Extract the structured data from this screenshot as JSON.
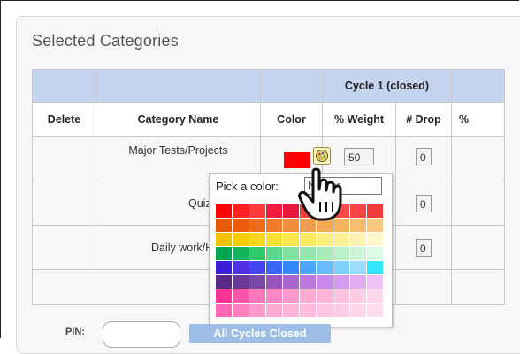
{
  "section_title": "Selected Categories",
  "table": {
    "group_header": "Cycle 1 (closed)",
    "columns": [
      "Delete",
      "Category Name",
      "Color",
      "% Weight",
      "# Drop",
      "%"
    ],
    "rows": [
      {
        "category": "Major Tests/Projects",
        "weight": "50",
        "drop": "0",
        "color": "#ff0000"
      },
      {
        "category": "Quiz/lab",
        "weight": "",
        "drop": "0"
      },
      {
        "category": "Daily work/Ho",
        "weight": "",
        "drop": "0"
      }
    ],
    "total_fragment": "0"
  },
  "color_picker": {
    "label": "Pick a color:",
    "input_value": "Noolor",
    "palette": [
      "#ff0000",
      "#ff2020",
      "#ff3b3b",
      "#f21d3e",
      "#e8193a",
      "#f33e3e",
      "#ff5a4c",
      "#ff4848",
      "#f74444",
      "#f23b3b",
      "#e85a00",
      "#ea5c0b",
      "#ee6b1a",
      "#f07a2a",
      "#f28b3a",
      "#f29d4d",
      "#f5a955",
      "#f7b460",
      "#f7bd70",
      "#f7c880",
      "#f2c200",
      "#f5cc00",
      "#f7d51a",
      "#f9de33",
      "#fbe64d",
      "#fbe866",
      "#fdee80",
      "#fdf099",
      "#fef3b3",
      "#fff7cc",
      "#00a651",
      "#14b35c",
      "#2ec96d",
      "#5cd68a",
      "#80e0a0",
      "#93e6ac",
      "#a5eab8",
      "#b8f0c8",
      "#cbf5d6",
      "#ddfae5",
      "#3c1fd6",
      "#5030e0",
      "#4444f0",
      "#3a66f3",
      "#3388ff",
      "#4aa6ff",
      "#66bbff",
      "#7fcfff",
      "#99ddff",
      "#33e6ff",
      "#5a2a8a",
      "#6a3a9a",
      "#7a48a8",
      "#9955bb",
      "#aa66cc",
      "#bb77dd",
      "#cc88ee",
      "#d89af0",
      "#e4acf3",
      "#f0bff6",
      "#ff3399",
      "#ff55aa",
      "#ff77bb",
      "#ff88c4",
      "#ff99cc",
      "#ffaad4",
      "#ffb3d9",
      "#ffc2e0",
      "#ffcce6",
      "#ffd6eb",
      "#ff66b3",
      "#ff80bf",
      "#ff99cc",
      "#ffaad4",
      "#ffb3d9",
      "#ffbbdd",
      "#ffc4e1",
      "#ffcce6",
      "#ffd5ea",
      "#ffddef"
    ]
  },
  "footer": {
    "pin_label": "PIN:",
    "pin_value": "",
    "all_cycles_button": "All Cycles Closed"
  }
}
